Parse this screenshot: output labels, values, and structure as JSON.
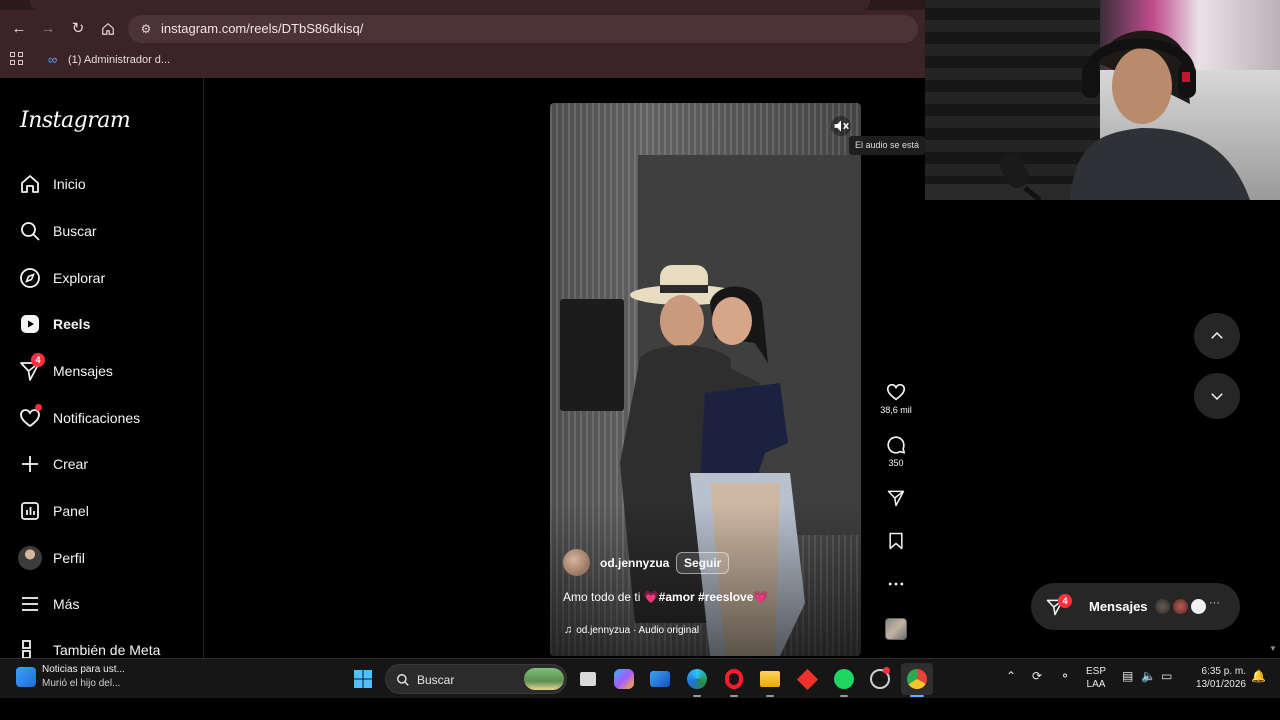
{
  "browser": {
    "url": "instagram.com/reels/DTbS86dkisq/",
    "bookmark_label": "(1) Administrador d..."
  },
  "sidebar": {
    "logo": "Instagram",
    "items": [
      {
        "label": "Inicio",
        "icon": "home-icon"
      },
      {
        "label": "Buscar",
        "icon": "search-icon"
      },
      {
        "label": "Explorar",
        "icon": "compass-icon"
      },
      {
        "label": "Reels",
        "icon": "reels-icon",
        "active": true
      },
      {
        "label": "Mensajes",
        "icon": "messenger-icon",
        "badge": "4"
      },
      {
        "label": "Notificaciones",
        "icon": "heart-icon",
        "dot": true
      },
      {
        "label": "Crear",
        "icon": "plus-icon"
      },
      {
        "label": "Panel",
        "icon": "dashboard-icon"
      },
      {
        "label": "Perfil",
        "icon": "avatar"
      },
      {
        "label": "Más",
        "icon": "menu-icon"
      },
      {
        "label": "También de Meta",
        "icon": "meta-apps-icon"
      }
    ]
  },
  "reel": {
    "username": "od.jennyzua",
    "follow_label": "Seguir",
    "caption_text": "Amo todo de ti ",
    "caption_heart": "💗",
    "caption_tags": "#amor #reeslove",
    "audio": "od.jennyzua · Audio original",
    "tooltip": "El audio se está"
  },
  "actions": {
    "likes": "38,6 mil",
    "comments": "350"
  },
  "messages_pill": {
    "label": "Mensajes",
    "badge": "4"
  },
  "taskbar": {
    "news_title": "Noticias para ust...",
    "news_subtitle": "Murió el hijo del...",
    "search_label": "Buscar",
    "lang_line1": "ESP",
    "lang_line2": "LAA",
    "time": "6:35 p. m.",
    "date": "13/01/2026"
  },
  "colors": {
    "badge_red": "#ff3040",
    "chrome_bg": "#3a2427",
    "ig_bg": "#000000"
  }
}
